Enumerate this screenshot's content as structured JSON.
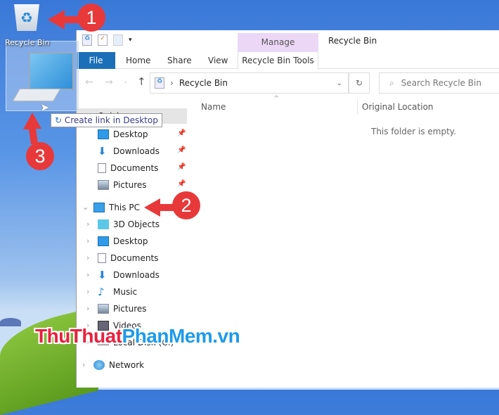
{
  "desktop": {
    "recycle_bin_label": "Recycle Bin",
    "tooltip": "Create link in Desktop"
  },
  "window": {
    "title": "Recycle Bin",
    "context_tab_group": "Manage",
    "tabs": [
      "File",
      "Home",
      "Share",
      "View",
      "Recycle Bin Tools"
    ],
    "address": "Recycle Bin",
    "search_placeholder": "Search Recycle Bin",
    "columns": [
      "Name",
      "Original Location"
    ],
    "empty_text": "This folder is empty.",
    "quick_access_label": "Quick access",
    "quick_access": [
      "Desktop",
      "Downloads",
      "Documents",
      "Pictures"
    ],
    "this_pc": "This PC",
    "this_pc_items": [
      "3D Objects",
      "Desktop",
      "Documents",
      "Downloads",
      "Music",
      "Pictures",
      "Videos",
      "Local Disk (C:)"
    ],
    "network": "Network"
  },
  "annotations": [
    "1",
    "2",
    "3"
  ],
  "watermark": {
    "part1": "ThuThuat",
    "part2": "PhanMem.vn"
  },
  "colors": {
    "accent": "#1a6fb8",
    "annotation": "#e8393a",
    "manage": "#ecd7f7"
  }
}
